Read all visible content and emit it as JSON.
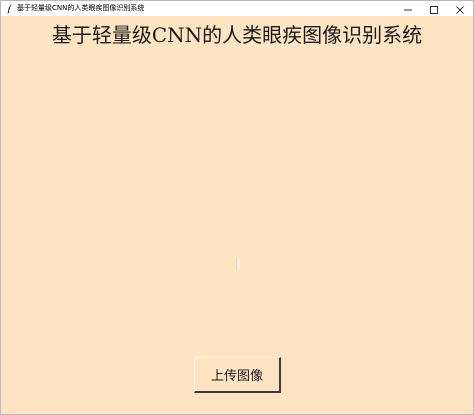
{
  "window": {
    "title": "基于轻量级CNN的人类眼疾图像识别系统",
    "icon": "feather-icon",
    "controls": [
      "minimize-icon",
      "maximize-icon",
      "close-icon"
    ]
  },
  "main": {
    "heading": "基于轻量级CNN的人类眼疾图像识别系统",
    "upload_button_label": "上传图像"
  },
  "colors": {
    "background": "#ffe4c4",
    "titlebar": "#ffffff"
  }
}
